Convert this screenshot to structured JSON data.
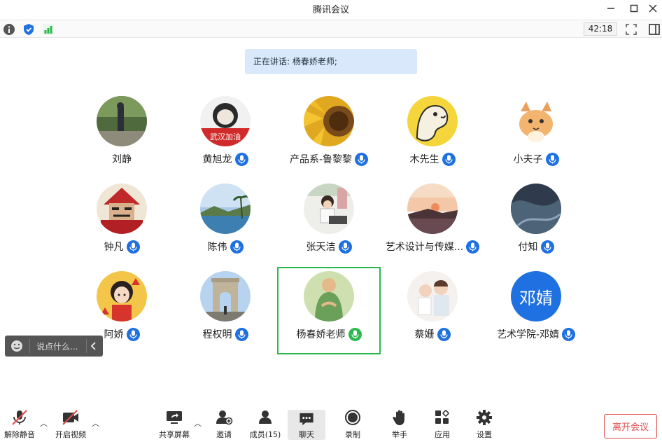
{
  "window": {
    "title": "腾讯会议"
  },
  "toolbar": {
    "timer": "42:18"
  },
  "speaking": {
    "text": "正在讲话: 杨春娇老师;"
  },
  "participants": [
    {
      "name": "刘静",
      "mic": "none"
    },
    {
      "name": "黄旭龙",
      "mic": "muted",
      "avatar_text": "武汉加油"
    },
    {
      "name": "产品系-鲁黎黎",
      "mic": "muted"
    },
    {
      "name": "木先生",
      "mic": "muted"
    },
    {
      "name": "小夫子",
      "mic": "muted"
    },
    {
      "name": "钟凡",
      "mic": "muted"
    },
    {
      "name": "陈伟",
      "mic": "muted"
    },
    {
      "name": "张天洁",
      "mic": "muted"
    },
    {
      "name": "艺术设计与传媒...",
      "mic": "muted"
    },
    {
      "name": "付知",
      "mic": "muted"
    },
    {
      "name": "阿娇",
      "mic": "muted"
    },
    {
      "name": "程权明",
      "mic": "muted"
    },
    {
      "name": "杨春娇老师",
      "mic": "speaking"
    },
    {
      "name": "蔡姗",
      "mic": "muted"
    },
    {
      "name": "艺术学院-邓婧",
      "mic": "muted",
      "avatar_text": "邓婧"
    }
  ],
  "chat": {
    "placeholder": "说点什么..."
  },
  "bottom": {
    "unmute": "解除静音",
    "video": "开启视频",
    "share": "共享屏幕",
    "invite": "邀请",
    "members": "成员(15)",
    "chat": "聊天",
    "record": "录制",
    "raise": "举手",
    "apps": "应用",
    "settings": "设置",
    "leave": "离开会议"
  },
  "colors": {
    "accent": "#1f70e0",
    "speaking": "#2db84d",
    "leave": "#e34b4b"
  }
}
